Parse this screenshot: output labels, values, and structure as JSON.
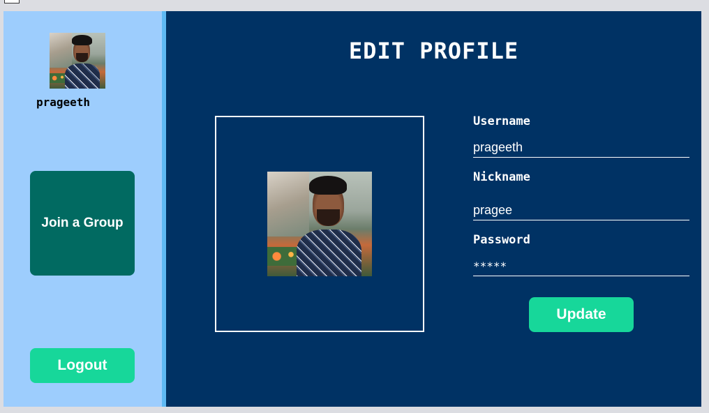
{
  "sidebar": {
    "username": "prageeth",
    "join_group_label": "Join a Group",
    "logout_label": "Logout"
  },
  "main": {
    "title": "EDIT PROFILE",
    "fields": {
      "username": {
        "label": "Username",
        "value": "prageeth"
      },
      "nickname": {
        "label": "Nickname",
        "value": "pragee"
      },
      "password": {
        "label": "Password",
        "value": "*****"
      }
    },
    "update_label": "Update"
  },
  "colors": {
    "sidebar_bg": "#9dcdfd",
    "main_bg": "#003264",
    "join_group_bg": "#016a61",
    "accent_button": "#17d79a"
  }
}
